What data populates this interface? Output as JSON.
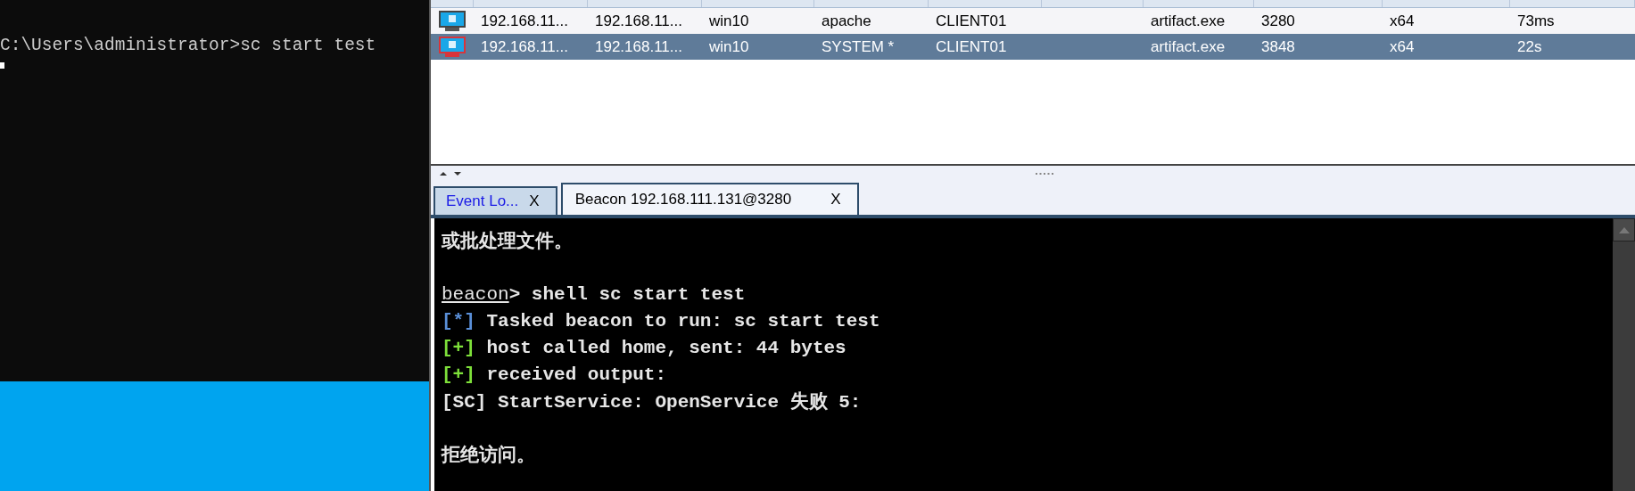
{
  "terminal": {
    "lines": [
      "C:\\Users\\administrator>sc start test"
    ],
    "cursor": true
  },
  "sessions": {
    "rows": [
      {
        "elevated": false,
        "selected": false,
        "cells": [
          "192.168.11...",
          "192.168.11...",
          "win10",
          "apache",
          "CLIENT01",
          "",
          "artifact.exe",
          "3280",
          "x64",
          "73ms"
        ]
      },
      {
        "elevated": true,
        "selected": true,
        "cells": [
          "192.168.11...",
          "192.168.11...",
          "win10",
          "SYSTEM *",
          "CLIENT01",
          "",
          "artifact.exe",
          "3848",
          "x64",
          "22s"
        ]
      }
    ]
  },
  "tabs": [
    {
      "label": "Event Lo...",
      "close": "X",
      "selected": false
    },
    {
      "label": "Beacon 192.168.111.131@3280",
      "close": "X",
      "selected": true
    }
  ],
  "console": [
    {
      "kind": "output",
      "text": "或批处理文件。"
    },
    {
      "kind": "blank"
    },
    {
      "kind": "prompt",
      "prompt": "beacon",
      "text": "> shell sc start test"
    },
    {
      "kind": "status",
      "marker": "[*]",
      "color": "#5a8fd8",
      "text": "Tasked beacon to run: sc start test"
    },
    {
      "kind": "status",
      "marker": "[+]",
      "color": "#7ee03a",
      "text": "host called home, sent: 44 bytes"
    },
    {
      "kind": "status",
      "marker": "[+]",
      "color": "#7ee03a",
      "text": "received output:"
    },
    {
      "kind": "output",
      "text": "[SC] StartService: OpenService 失败 5:"
    },
    {
      "kind": "blank"
    },
    {
      "kind": "output",
      "text": "拒绝访问。"
    }
  ]
}
